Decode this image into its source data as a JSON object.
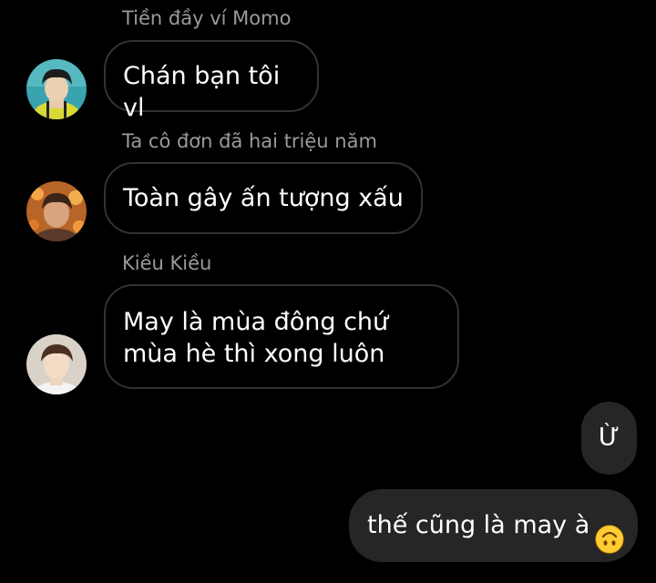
{
  "messages": [
    {
      "sender": "Tiền đầy ví Momo",
      "text": "Chán bạn tôi vl",
      "avatar": "avatar-boy-yellow-shirt"
    },
    {
      "sender": "Ta cô đơn đã hai triệu năm",
      "text": "Toàn gây ấn tượng xấu",
      "avatar": "avatar-boy-orange-lights"
    },
    {
      "sender": "Kiều Kiều",
      "text_line1": "May là mùa đông chứ",
      "text_line2": "mùa hè thì xong luôn",
      "avatar": "avatar-boy-white-shirt"
    }
  ],
  "outgoing": [
    {
      "text": "Ừ"
    },
    {
      "text": "thế cũng là may à",
      "emoji": "upside-down-face-emoji"
    }
  ],
  "colors": {
    "background": "#000000",
    "incoming_bubble_border": "#333333",
    "outgoing_bubble": "#262626",
    "sender_name": "#9a9a9a",
    "text": "#ffffff"
  }
}
